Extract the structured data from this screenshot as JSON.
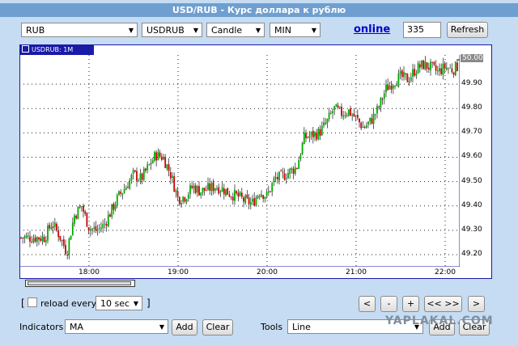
{
  "title": "USD/RUB - Курс доллара к рублю",
  "toolbar": {
    "currency": "RUB",
    "pair": "USDRUB",
    "chart_type": "Candle",
    "period": "MIN",
    "online_label": "online",
    "count_value": "335",
    "refresh_label": "Refresh"
  },
  "chart": {
    "tab_label": "USDRUB: 1M",
    "current_price": "50.00",
    "y_ticks": [
      "49.90",
      "49.80",
      "49.70",
      "49.60",
      "49.50",
      "49.40",
      "49.30",
      "49.20"
    ],
    "x_ticks": [
      "18:00",
      "19:00",
      "20:00",
      "21:00",
      "22:00"
    ]
  },
  "chart_data": {
    "type": "candlestick",
    "title": "USDRUB: 1M",
    "xlabel": "",
    "ylabel": "",
    "ylim": [
      49.15,
      50.02
    ],
    "x_ticks": [
      "18:00",
      "19:00",
      "20:00",
      "21:00",
      "22:00"
    ],
    "y_ticks": [
      49.2,
      49.3,
      49.4,
      49.5,
      49.6,
      49.7,
      49.8,
      49.9
    ],
    "last_price": 50.0,
    "up_color": "#00aa00",
    "down_color": "#cc0000",
    "close_path": [
      {
        "time": "17:30",
        "value": 49.27
      },
      {
        "time": "17:35",
        "value": 49.33
      },
      {
        "time": "17:40",
        "value": 49.28
      },
      {
        "time": "17:45",
        "value": 49.21
      },
      {
        "time": "17:50",
        "value": 49.36
      },
      {
        "time": "17:55",
        "value": 49.4
      },
      {
        "time": "18:00",
        "value": 49.31
      },
      {
        "time": "18:05",
        "value": 49.3
      },
      {
        "time": "18:10",
        "value": 49.32
      },
      {
        "time": "18:15",
        "value": 49.38
      },
      {
        "time": "18:20",
        "value": 49.44
      },
      {
        "time": "18:25",
        "value": 49.48
      },
      {
        "time": "18:30",
        "value": 49.53
      },
      {
        "time": "18:35",
        "value": 49.51
      },
      {
        "time": "18:40",
        "value": 49.56
      },
      {
        "time": "18:45",
        "value": 49.61
      },
      {
        "time": "18:50",
        "value": 49.6
      },
      {
        "time": "18:55",
        "value": 49.53
      },
      {
        "time": "19:00",
        "value": 49.43
      },
      {
        "time": "19:05",
        "value": 49.44
      },
      {
        "time": "19:10",
        "value": 49.48
      },
      {
        "time": "19:15",
        "value": 49.46
      },
      {
        "time": "19:20",
        "value": 49.47
      },
      {
        "time": "19:25",
        "value": 49.48
      },
      {
        "time": "19:30",
        "value": 49.47
      },
      {
        "time": "19:35",
        "value": 49.45
      },
      {
        "time": "19:40",
        "value": 49.44
      },
      {
        "time": "19:45",
        "value": 49.42
      },
      {
        "time": "19:50",
        "value": 49.41
      },
      {
        "time": "19:55",
        "value": 49.46
      },
      {
        "time": "20:00",
        "value": 49.44
      },
      {
        "time": "20:05",
        "value": 49.51
      },
      {
        "time": "20:10",
        "value": 49.52
      },
      {
        "time": "20:15",
        "value": 49.54
      },
      {
        "time": "20:20",
        "value": 49.56
      },
      {
        "time": "20:25",
        "value": 49.68
      },
      {
        "time": "20:30",
        "value": 49.69
      },
      {
        "time": "20:35",
        "value": 49.7
      },
      {
        "time": "20:40",
        "value": 49.74
      },
      {
        "time": "20:45",
        "value": 49.8
      },
      {
        "time": "20:50",
        "value": 49.78
      },
      {
        "time": "20:55",
        "value": 49.79
      },
      {
        "time": "21:00",
        "value": 49.76
      },
      {
        "time": "21:05",
        "value": 49.72
      },
      {
        "time": "21:10",
        "value": 49.75
      },
      {
        "time": "21:15",
        "value": 49.8
      },
      {
        "time": "21:20",
        "value": 49.88
      },
      {
        "time": "21:25",
        "value": 49.91
      },
      {
        "time": "21:30",
        "value": 49.93
      },
      {
        "time": "21:35",
        "value": 49.92
      },
      {
        "time": "21:40",
        "value": 49.96
      },
      {
        "time": "21:45",
        "value": 49.98
      },
      {
        "time": "21:50",
        "value": 49.97
      },
      {
        "time": "21:55",
        "value": 49.95
      },
      {
        "time": "22:00",
        "value": 49.97
      },
      {
        "time": "22:05",
        "value": 49.96
      },
      {
        "time": "22:10",
        "value": 49.98
      },
      {
        "time": "22:15",
        "value": 50.0
      }
    ]
  },
  "controls": {
    "reload_label": "reload every",
    "reload_value": "10 sec",
    "bracket_open": "[",
    "bracket_close": "]",
    "nav_buttons": [
      "<",
      "-",
      "+",
      "<< >>",
      ">"
    ]
  },
  "indicators": {
    "label": "Indicators",
    "value": "MA",
    "add_label": "Add",
    "clear_label": "Clear"
  },
  "tools": {
    "label": "Tools",
    "value": "Line",
    "add_label": "Add",
    "clear_label": "Clear"
  },
  "watermark": "YAPLAKAL.COM"
}
